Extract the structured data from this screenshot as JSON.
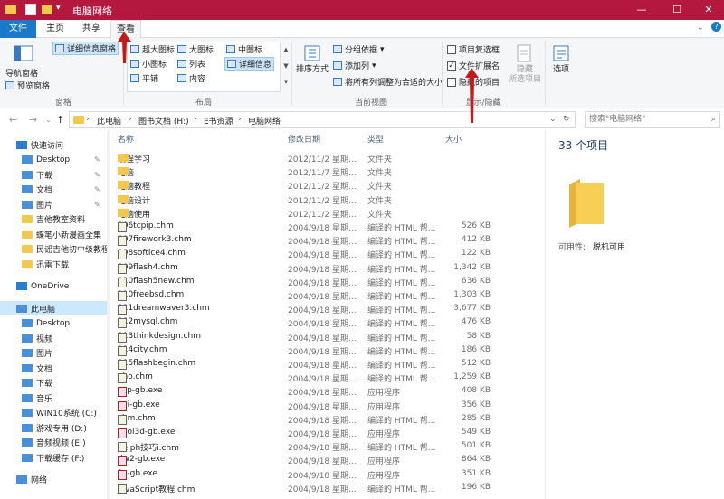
{
  "window": {
    "title": "电脑网络",
    "min": "—",
    "max": "☐",
    "close": "✕"
  },
  "tabs": [
    "文件",
    "主页",
    "共享",
    "查看"
  ],
  "ribbon": {
    "nav_pane": "导航窗格",
    "preview_pane": "预览窗格",
    "details_pane": "详细信息窗格",
    "layout_items": [
      "超大图标",
      "大图标",
      "中图标",
      "小图标",
      "列表",
      "详细信息",
      "平铺",
      "内容"
    ],
    "sort": "排序方式",
    "group_by": "分组依据",
    "add_column": "添加列",
    "fit_columns": "将所有列调整为合适的大小",
    "checkboxes": [
      {
        "label": "项目复选框",
        "checked": false
      },
      {
        "label": "文件扩展名",
        "checked": true
      },
      {
        "label": "隐藏的项目",
        "checked": false
      }
    ],
    "hide_selected": "隐藏",
    "hide_selected2": "所选项目",
    "options": "选项",
    "groups": [
      "窗格",
      "布局",
      "当前视图",
      "显示/隐藏"
    ]
  },
  "address": {
    "crumbs": [
      "此电脑",
      "图书文档 (H:)",
      "E书资源",
      "电脑网络"
    ],
    "search_placeholder": "搜索\"电脑网络\""
  },
  "nav": [
    {
      "label": "快速访问",
      "type": "star"
    },
    {
      "label": "Desktop",
      "type": "desk",
      "pin": true
    },
    {
      "label": "下载",
      "type": "down",
      "pin": true
    },
    {
      "label": "文档",
      "type": "doc",
      "pin": true
    },
    {
      "label": "图片",
      "type": "pic",
      "pin": true
    },
    {
      "label": "吉他教室资料",
      "type": "folder"
    },
    {
      "label": "蝶笔小新漫画全集",
      "type": "folder"
    },
    {
      "label": "民谣吉他初中级教程",
      "type": "folder"
    },
    {
      "label": "迅雷下载",
      "type": "folder"
    },
    {
      "label": "",
      "type": "gap"
    },
    {
      "label": "OneDrive",
      "type": "cloud"
    },
    {
      "label": "",
      "type": "gap"
    },
    {
      "label": "此电脑",
      "type": "pc",
      "selected": true
    },
    {
      "label": "Desktop",
      "type": "desk"
    },
    {
      "label": "视频",
      "type": "vid"
    },
    {
      "label": "图片",
      "type": "pic"
    },
    {
      "label": "文档",
      "type": "doc"
    },
    {
      "label": "下载",
      "type": "down"
    },
    {
      "label": "音乐",
      "type": "music"
    },
    {
      "label": "WIN10系统 (C:)",
      "type": "drive"
    },
    {
      "label": "游戏专用 (D:)",
      "type": "drive"
    },
    {
      "label": "音频视频 (E:)",
      "type": "drive"
    },
    {
      "label": "下载缓存 (F:)",
      "type": "drive"
    },
    {
      "label": "",
      "type": "gap"
    },
    {
      "label": "网络",
      "type": "net"
    }
  ],
  "columns": [
    "名称",
    "修改日期",
    "类型",
    "大小"
  ],
  "files": [
    {
      "name": "编程学习",
      "date": "2012/11/2 星期...",
      "type": "文件夹",
      "size": "",
      "icon": "folder"
    },
    {
      "name": "电脑",
      "date": "2012/11/7 星期...",
      "type": "文件夹",
      "size": "",
      "icon": "folder"
    },
    {
      "name": "电脑教程",
      "date": "2012/11/2 星期...",
      "type": "文件夹",
      "size": "",
      "icon": "folder"
    },
    {
      "name": "电脑设计",
      "date": "2012/11/2 星期...",
      "type": "文件夹",
      "size": "",
      "icon": "folder"
    },
    {
      "name": "电脑使用",
      "date": "2012/11/2 星期...",
      "type": "文件夹",
      "size": "",
      "icon": "folder"
    },
    {
      "name": "006tcpip.chm",
      "date": "2004/9/18 星期...",
      "type": "编译的 HTML 帮...",
      "size": "526 KB",
      "icon": "chm"
    },
    {
      "name": "007firework3.chm",
      "date": "2004/9/18 星期...",
      "type": "编译的 HTML 帮...",
      "size": "412 KB",
      "icon": "chm"
    },
    {
      "name": "008softice4.chm",
      "date": "2004/9/18 星期...",
      "type": "编译的 HTML 帮...",
      "size": "122 KB",
      "icon": "chm"
    },
    {
      "name": "009flash4.chm",
      "date": "2004/9/18 星期...",
      "type": "编译的 HTML 帮...",
      "size": "1,342 KB",
      "icon": "chm"
    },
    {
      "name": "010flash5new.chm",
      "date": "2004/9/18 星期...",
      "type": "编译的 HTML 帮...",
      "size": "636 KB",
      "icon": "chm"
    },
    {
      "name": "010freebsd.chm",
      "date": "2004/9/18 星期...",
      "type": "编译的 HTML 帮...",
      "size": "1,303 KB",
      "icon": "chm"
    },
    {
      "name": "011dreamwaver3.chm",
      "date": "2004/9/18 星期...",
      "type": "编译的 HTML 帮...",
      "size": "3,677 KB",
      "icon": "chm"
    },
    {
      "name": "012mysql.chm",
      "date": "2004/9/18 星期...",
      "type": "编译的 HTML 帮...",
      "size": "476 KB",
      "icon": "chm"
    },
    {
      "name": "013thinkdesign.chm",
      "date": "2004/9/18 星期...",
      "type": "编译的 HTML 帮...",
      "size": "58 KB",
      "icon": "chm"
    },
    {
      "name": "014city.chm",
      "date": "2004/9/18 星期...",
      "type": "编译的 HTML 帮...",
      "size": "186 KB",
      "icon": "chm"
    },
    {
      "name": "015flashbegin.chm",
      "date": "2004/9/18 星期...",
      "type": "编译的 HTML 帮...",
      "size": "512 KB",
      "icon": "chm"
    },
    {
      "name": "aho.chm",
      "date": "2004/9/18 星期...",
      "type": "编译的 HTML 帮...",
      "size": "1,259 KB",
      "icon": "chm"
    },
    {
      "name": "asp-gb.exe",
      "date": "2004/9/18 星期...",
      "type": "应用程序",
      "size": "408 KB",
      "icon": "exe"
    },
    {
      "name": "cgi-gb.exe",
      "date": "2004/9/18 星期...",
      "type": "应用程序",
      "size": "356 KB",
      "icon": "exe"
    },
    {
      "name": "chm.chm",
      "date": "2004/9/18 星期...",
      "type": "编译的 HTML 帮...",
      "size": "285 KB",
      "icon": "chm"
    },
    {
      "name": "cool3d-gb.exe",
      "date": "2004/9/18 星期...",
      "type": "应用程序",
      "size": "549 KB",
      "icon": "exe"
    },
    {
      "name": "delph技巧i.chm",
      "date": "2004/9/18 星期...",
      "type": "编译的 HTML 帮...",
      "size": "501 KB",
      "icon": "chm"
    },
    {
      "name": "dw2-gb.exe",
      "date": "2004/9/18 星期...",
      "type": "应用程序",
      "size": "864 KB",
      "icon": "exe"
    },
    {
      "name": "fw-gb.exe",
      "date": "2004/9/18 星期...",
      "type": "应用程序",
      "size": "351 KB",
      "icon": "exe"
    },
    {
      "name": "JavaScript教程.chm",
      "date": "2004/9/18 星期...",
      "type": "编译的 HTML 帮...",
      "size": "196 KB",
      "icon": "chm"
    }
  ],
  "preview": {
    "count": "33 个项目",
    "availability_label": "可用性:",
    "availability_value": "脱机可用"
  },
  "colors": {
    "titlebar": "#b5183f",
    "file_tab": "#1979ca",
    "selection": "#cce8ff",
    "annotation": "#c41a1a"
  }
}
